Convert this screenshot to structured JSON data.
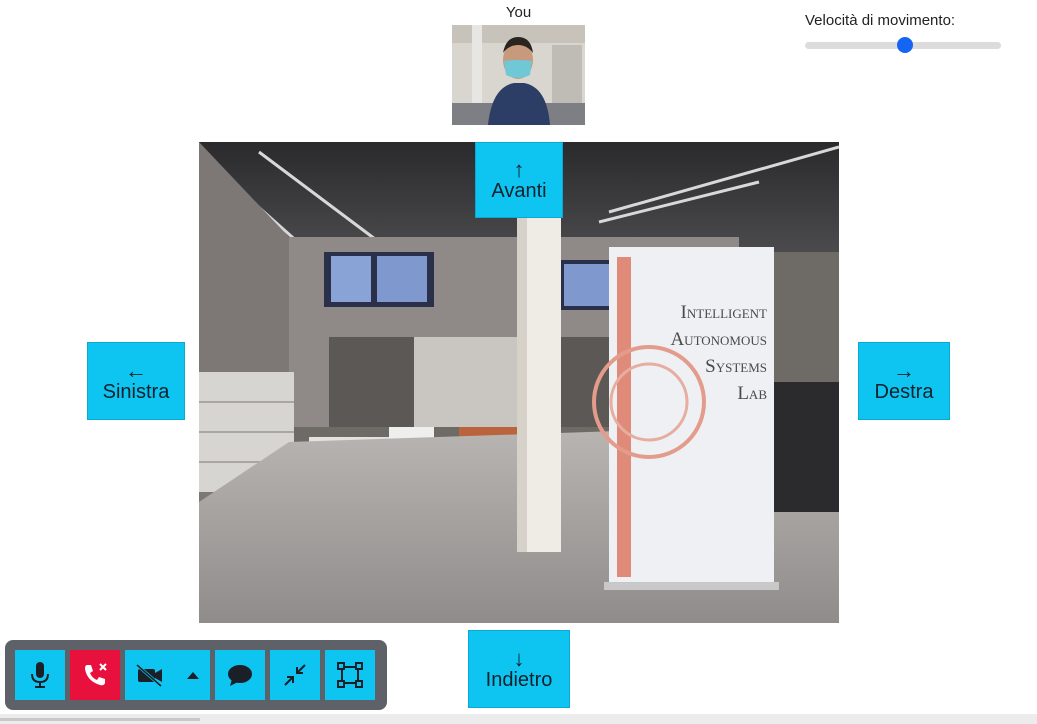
{
  "self_view": {
    "label": "You"
  },
  "speed": {
    "label": "Velocità di movimento:",
    "value_fraction": 0.51,
    "accent": "#1565f5"
  },
  "controls": {
    "forward": {
      "arrow": "↑",
      "label": "Avanti"
    },
    "left": {
      "arrow": "←",
      "label": "Sinistra"
    },
    "right": {
      "arrow": "→",
      "label": "Destra"
    },
    "back": {
      "arrow": "↓",
      "label": "Indietro"
    },
    "button_color": "#0ec4f0"
  },
  "banner": {
    "line1": "Intelligent",
    "line2": "Autonomous",
    "line3": "Systems",
    "line4": "Lab"
  },
  "toolbar": {
    "icons": [
      "microphone-icon",
      "hang-up-icon",
      "camera-off-icon",
      "caret-up-icon",
      "chat-icon",
      "exit-fullscreen-icon",
      "focus-frame-icon"
    ],
    "hangup_color": "#e8103c"
  }
}
